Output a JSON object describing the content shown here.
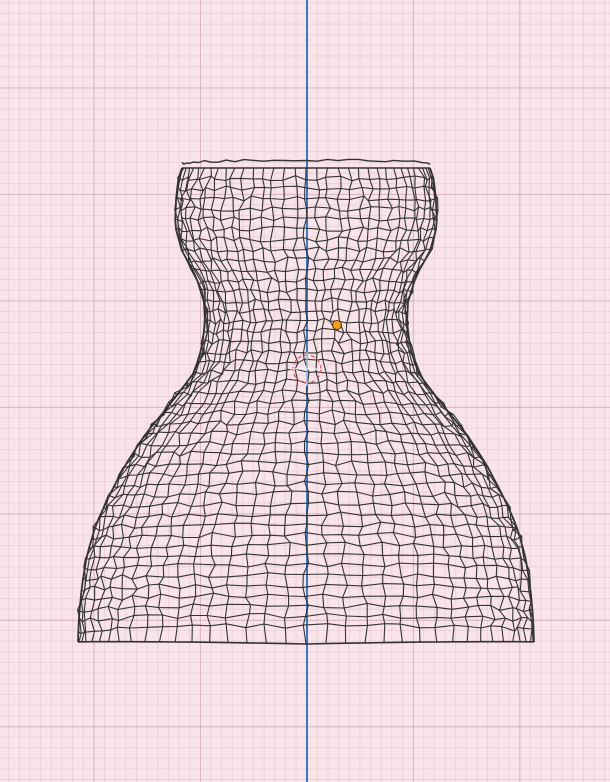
{
  "viewport": {
    "background_color": "#f9e4ea",
    "grid_major_color": "#d6b2bf",
    "grid_minor_color": "#ebcbd5",
    "axis_color": "#3a78c8"
  },
  "mesh": {
    "object": "dress-wireframe",
    "wire_color": "#333333"
  },
  "origin": {
    "color": "#f0a020"
  },
  "cursor": {
    "icon": "3d-cursor-icon",
    "ring_color": "#e05050",
    "cross_color": "#ffffff"
  }
}
